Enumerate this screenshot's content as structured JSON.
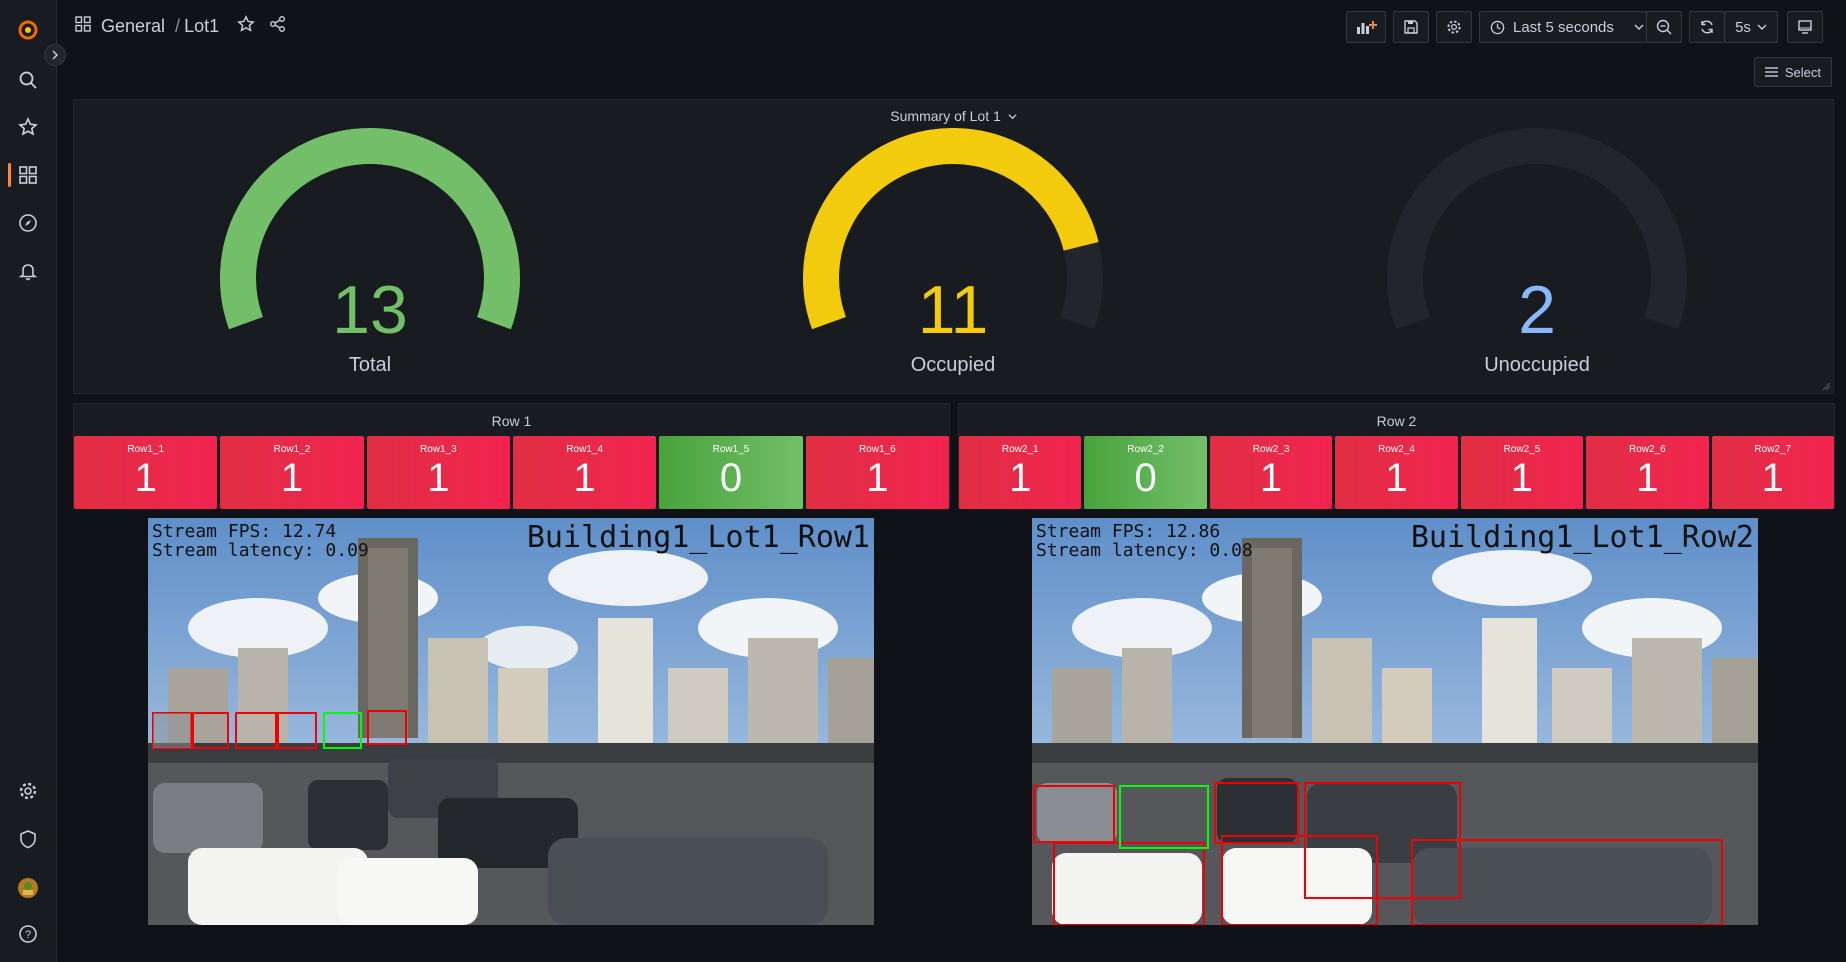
{
  "breadcrumb": {
    "folder": "General",
    "separator": "/",
    "dashboard": "Lot1"
  },
  "toolbar": {
    "time_range": "Last 5 seconds",
    "refresh_interval": "5s",
    "select_label": "Select"
  },
  "summary_panel": {
    "title": "Summary of Lot 1",
    "gauges": [
      {
        "value": "13",
        "label": "Total",
        "color": "#73bf69",
        "fraction": 1.0
      },
      {
        "value": "11",
        "label": "Occupied",
        "color": "#f2cc0c",
        "fraction": 0.846
      },
      {
        "value": "2",
        "label": "Unoccupied",
        "color": "#8ab8ff",
        "fraction": 0.0
      }
    ]
  },
  "row1": {
    "title": "Row 1",
    "stats": [
      {
        "label": "Row1_1",
        "value": "1",
        "status": "occupied"
      },
      {
        "label": "Row1_2",
        "value": "1",
        "status": "occupied"
      },
      {
        "label": "Row1_3",
        "value": "1",
        "status": "occupied"
      },
      {
        "label": "Row1_4",
        "value": "1",
        "status": "occupied"
      },
      {
        "label": "Row1_5",
        "value": "0",
        "status": "free"
      },
      {
        "label": "Row1_6",
        "value": "1",
        "status": "occupied"
      }
    ],
    "camera": {
      "fps_text": "Stream FPS: 12.74",
      "latency_text": "Stream latency: 0.09",
      "name": "Building1_Lot1_Row1"
    }
  },
  "row2": {
    "title": "Row 2",
    "stats": [
      {
        "label": "Row2_1",
        "value": "1",
        "status": "occupied"
      },
      {
        "label": "Row2_2",
        "value": "0",
        "status": "free"
      },
      {
        "label": "Row2_3",
        "value": "1",
        "status": "occupied"
      },
      {
        "label": "Row2_4",
        "value": "1",
        "status": "occupied"
      },
      {
        "label": "Row2_5",
        "value": "1",
        "status": "occupied"
      },
      {
        "label": "Row2_6",
        "value": "1",
        "status": "occupied"
      },
      {
        "label": "Row2_7",
        "value": "1",
        "status": "occupied"
      }
    ],
    "camera": {
      "fps_text": "Stream FPS: 12.86",
      "latency_text": "Stream latency: 0.08",
      "name": "Building1_Lot1_Row2"
    }
  },
  "colors": {
    "occupied": "#e02f44",
    "free": "#56a64b",
    "accent": "#ff8833"
  },
  "sidebar_icons": [
    "grafana-logo-icon",
    "search-icon",
    "star-icon",
    "dashboards-icon",
    "explore-icon",
    "alerting-icon",
    "gear-icon",
    "shield-icon",
    "avatar",
    "help-icon"
  ]
}
